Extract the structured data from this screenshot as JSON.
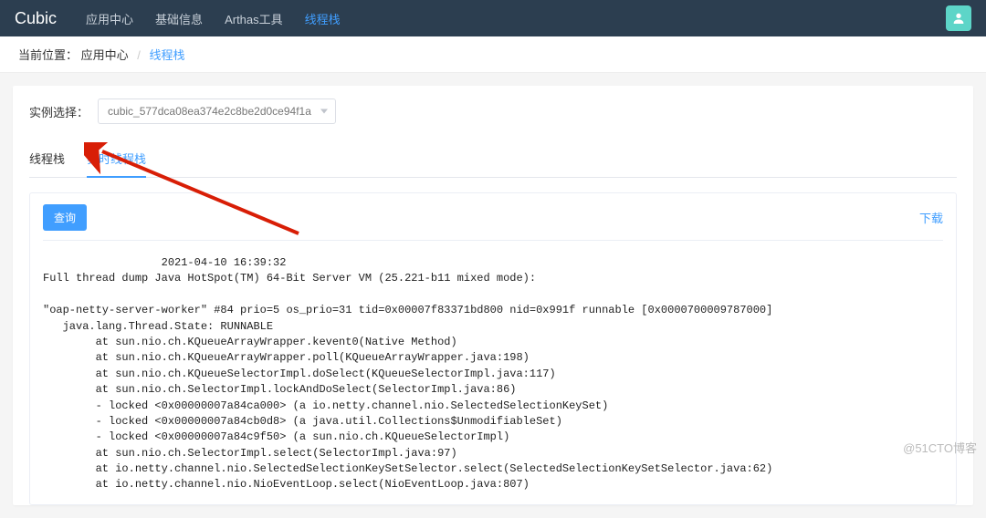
{
  "nav": {
    "brand": "Cubic",
    "items": [
      "应用中心",
      "基础信息",
      "Arthas工具",
      "线程栈"
    ],
    "activeIndex": 3
  },
  "breadcrumb": {
    "label": "当前位置：",
    "app": "应用中心",
    "sep": "/",
    "current": "线程栈"
  },
  "selector": {
    "label": "实例选择：",
    "value": "cubic_577dca08ea374e2c8be2d0ce94f1a"
  },
  "tabs": {
    "items": [
      "线程栈",
      "实时线程栈"
    ],
    "activeIndex": 1
  },
  "actions": {
    "query": "查询",
    "download": "下载"
  },
  "dump": "                  2021-04-10 16:39:32\nFull thread dump Java HotSpot(TM) 64-Bit Server VM (25.221-b11 mixed mode):\n\n\"oap-netty-server-worker\" #84 prio=5 os_prio=31 tid=0x00007f83371bd800 nid=0x991f runnable [0x0000700009787000]\n   java.lang.Thread.State: RUNNABLE\n        at sun.nio.ch.KQueueArrayWrapper.kevent0(Native Method)\n        at sun.nio.ch.KQueueArrayWrapper.poll(KQueueArrayWrapper.java:198)\n        at sun.nio.ch.KQueueSelectorImpl.doSelect(KQueueSelectorImpl.java:117)\n        at sun.nio.ch.SelectorImpl.lockAndDoSelect(SelectorImpl.java:86)\n        - locked <0x00000007a84ca000> (a io.netty.channel.nio.SelectedSelectionKeySet)\n        - locked <0x00000007a84cb0d8> (a java.util.Collections$UnmodifiableSet)\n        - locked <0x00000007a84c9f50> (a sun.nio.ch.KQueueSelectorImpl)\n        at sun.nio.ch.SelectorImpl.select(SelectorImpl.java:97)\n        at io.netty.channel.nio.SelectedSelectionKeySetSelector.select(SelectedSelectionKeySetSelector.java:62)\n        at io.netty.channel.nio.NioEventLoop.select(NioEventLoop.java:807)",
  "watermark": "@51CTO博客"
}
